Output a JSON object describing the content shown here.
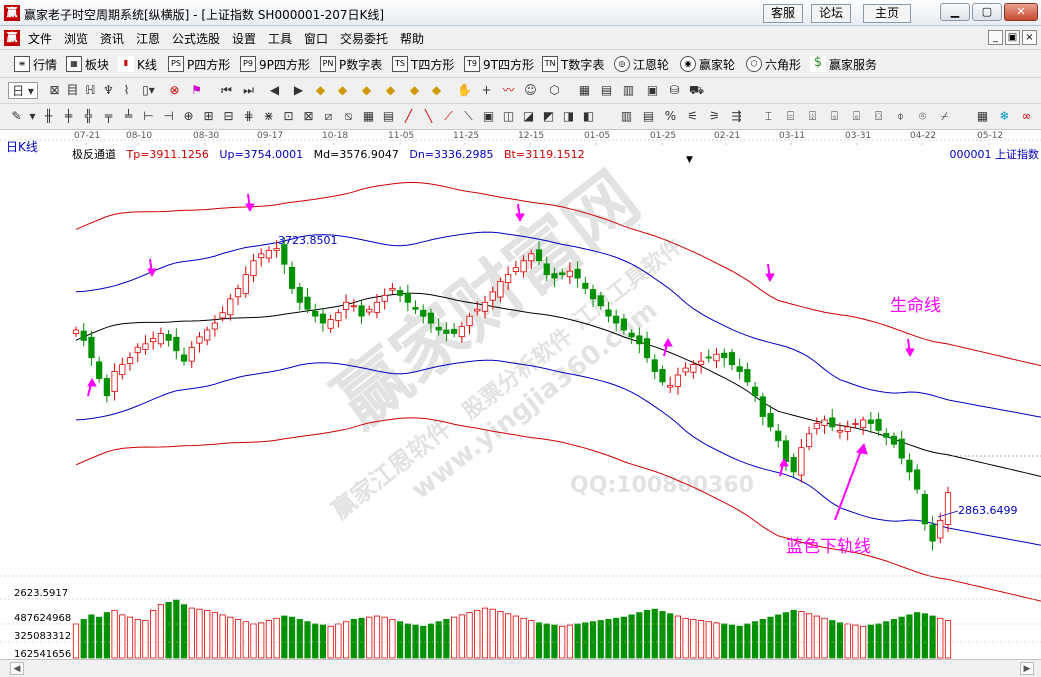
{
  "window": {
    "title": "赢家老子时空周期系统[纵横版] - [上证指数  SH000001-207日K线]",
    "app_icon": "赢",
    "buttons": [
      "客服",
      "论坛",
      "主页"
    ]
  },
  "menu": [
    "文件",
    "浏览",
    "资讯",
    "江恩",
    "公式选股",
    "设置",
    "工具",
    "窗口",
    "交易委托",
    "帮助"
  ],
  "toolbar1": [
    {
      "icon": "list-icon",
      "label": "行情"
    },
    {
      "icon": "blocks-icon",
      "label": "板块"
    },
    {
      "icon": "kline-icon",
      "label": "K线"
    },
    {
      "icon": "PS",
      "label": "P四方形"
    },
    {
      "icon": "P9",
      "label": "9P四方形"
    },
    {
      "icon": "PN",
      "label": "P数字表"
    },
    {
      "icon": "TS",
      "label": "T四方形"
    },
    {
      "icon": "T9",
      "label": "9T四方形"
    },
    {
      "icon": "TN",
      "label": "T数字表"
    },
    {
      "icon": "gann-wheel-icon",
      "label": "江恩轮"
    },
    {
      "icon": "winner-wheel-icon",
      "label": "赢家轮"
    },
    {
      "icon": "hexagon-icon",
      "label": "六角形"
    },
    {
      "icon": "dollar-icon",
      "label": "赢家服务"
    }
  ],
  "period_selector": "日",
  "chart": {
    "period_label": "日K线",
    "indicator_name": "极反通道",
    "tp": "Tp=3911.1256",
    "up": "Up=3754.0001",
    "md": "Md=3576.9047",
    "dn": "Dn=3336.2985",
    "bt": "Bt=3119.1512",
    "index_name": "000001  上证指数",
    "high_label": "3723.8501",
    "low_label": "2863.6499",
    "annotation_life": "生命线",
    "annotation_lower": "蓝色下轨线",
    "watermark_qq": "QQ:100800360",
    "watermark_site": "www.yingjia360.com",
    "watermark_main": "赢家财富网",
    "watermark_sub1": "赢家江恩软件",
    "watermark_sub2": "股票分析软件",
    "watermark_sub3": "江恩工具软件",
    "volume_labels": [
      "2623.5917",
      "487624968",
      "325083312",
      "162541656"
    ],
    "colors": {
      "up_candle": "#e00000",
      "down_candle": "#009000",
      "top_band": "#d00000",
      "mid_band": "#0000c0",
      "center": "#000000",
      "arrow": "#ff00ff"
    }
  },
  "time_axis": [
    "07-21",
    "08-10",
    "08-30",
    "09-17",
    "10-18",
    "11-05",
    "11-25",
    "12-15",
    "01-05",
    "01-25",
    "02-21",
    "03-11",
    "03-31",
    "04-22",
    "05-12"
  ],
  "chart_data": {
    "type": "candlestick",
    "title": "上证指数 000001 日K线",
    "x": [
      "07-21",
      "08-10",
      "08-30",
      "09-17",
      "10-18",
      "11-05",
      "11-25",
      "12-15",
      "01-05",
      "01-25",
      "02-21",
      "03-11",
      "03-31",
      "04-22",
      "05-12"
    ],
    "series": [
      {
        "name": "Tp",
        "value": 3911.1256
      },
      {
        "name": "Up",
        "value": 3754.0001
      },
      {
        "name": "Md",
        "value": 3576.9047
      },
      {
        "name": "Dn",
        "value": 3336.2985
      },
      {
        "name": "Bt",
        "value": 3119.1512
      }
    ],
    "annotations": [
      {
        "label": "3723.8501",
        "type": "high"
      },
      {
        "label": "2863.6499",
        "type": "low"
      }
    ],
    "close_series": [
      3480,
      3450,
      3400,
      3340,
      3290,
      3360,
      3380,
      3400,
      3430,
      3440,
      3455,
      3470,
      3450,
      3420,
      3390,
      3430,
      3460,
      3480,
      3500,
      3530,
      3570,
      3600,
      3640,
      3680,
      3700,
      3710,
      3715,
      3670,
      3600,
      3560,
      3540,
      3520,
      3500,
      3510,
      3530,
      3560,
      3550,
      3520,
      3540,
      3560,
      3580,
      3600,
      3580,
      3560,
      3540,
      3520,
      3500,
      3480,
      3470,
      3470,
      3490,
      3520,
      3540,
      3560,
      3590,
      3620,
      3640,
      3660,
      3680,
      3700,
      3680,
      3640,
      3630,
      3640,
      3650,
      3630,
      3600,
      3570,
      3550,
      3520,
      3500,
      3480,
      3460,
      3440,
      3400,
      3360,
      3330,
      3320,
      3350,
      3370,
      3380,
      3390,
      3400,
      3410,
      3400,
      3380,
      3360,
      3330,
      3290,
      3230,
      3200,
      3160,
      3100,
      3070,
      3140,
      3180,
      3210,
      3220,
      3200,
      3190,
      3200,
      3210,
      3220,
      3210,
      3190,
      3170,
      3150,
      3110,
      3070,
      3020,
      2920,
      2870,
      2930,
      3010
    ],
    "volume_series": [
      300,
      340,
      380,
      360,
      400,
      420,
      380,
      360,
      340,
      330,
      420,
      470,
      490,
      510,
      470,
      440,
      430,
      420,
      400,
      380,
      360,
      340,
      320,
      300,
      310,
      330,
      350,
      370,
      360,
      340,
      320,
      300,
      290,
      280,
      300,
      320,
      340,
      350,
      360,
      370,
      360,
      340,
      320,
      300,
      290,
      280,
      300,
      320,
      340,
      360,
      380,
      400,
      420,
      440,
      430,
      410,
      390,
      370,
      350,
      330,
      310,
      300,
      290,
      280,
      290,
      300,
      310,
      320,
      330,
      340,
      350,
      360,
      380,
      400,
      420,
      430,
      410,
      390,
      370,
      350,
      340,
      330,
      320,
      310,
      300,
      290,
      280,
      300,
      320,
      340,
      360,
      380,
      400,
      420,
      410,
      390,
      370,
      350,
      330,
      310,
      300,
      290,
      280,
      290,
      300,
      320,
      340,
      360,
      380,
      400,
      390,
      370,
      350,
      330
    ]
  }
}
